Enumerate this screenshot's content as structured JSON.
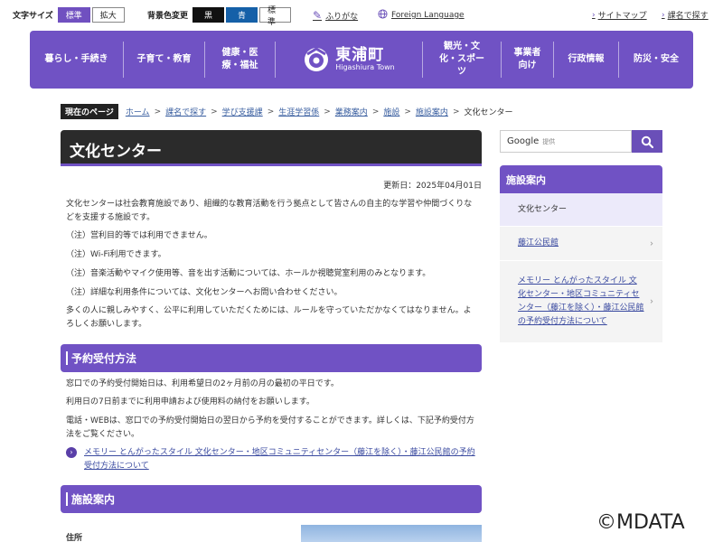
{
  "topbar": {
    "font_size_label": "文字サイズ",
    "font_size_options": [
      "標準",
      "拡大"
    ],
    "bg_label": "背景色変更",
    "bg_options": [
      "黒",
      "青",
      "標準"
    ],
    "furigana": "ふりがな",
    "foreign_language": "Foreign Language",
    "sitemap": "サイトマップ",
    "search_by_section": "課名で探す"
  },
  "nav": {
    "items_left": [
      "暮らし・手続き",
      "子育て・教育",
      "健康・医療・福祉"
    ],
    "logo_jp": "東浦町",
    "logo_en": "Higashiura Town",
    "items_right": [
      "観光・文化・スポーツ",
      "事業者向け",
      "行政情報",
      "防災・安全"
    ]
  },
  "breadcrumb": {
    "head": "現在のページ",
    "links": [
      "ホーム",
      "課名で探す",
      "学び支援課",
      "生涯学習係",
      "業務案内",
      "施設",
      "施設案内"
    ],
    "current": "文化センター"
  },
  "main": {
    "title": "文化センター",
    "updated": "更新日：2025年04月01日",
    "intro": "文化センターは社会教育施設であり、組織的な教育活動を行う拠点として皆さんの自主的な学習や仲間づくりなどを支援する施設です。",
    "notes": [
      "（注）営利目的等では利用できません。",
      "（注）Wi-Fi利用できます。",
      "（注）音楽活動やマイク使用等、音を出す活動については、ホールか視聴覚室利用のみとなります。",
      "（注）詳細な利用条件については、文化センターへお問い合わせください。"
    ],
    "closing": "多くの人に親しみやすく、公平に利用していただくためには、ルールを守っていただかなくてはなりません。よろしくお願いします。",
    "section1_title": "予約受付方法",
    "reserve_lines": [
      "窓口での予約受付開始日は、利用希望日の2ヶ月前の月の最初の平日です。",
      "利用日の7日前までに利用申請および使用料の納付をお願いします。",
      "電話・WEBは、窓口での予約受付開始日の翌日から予約を受付することができます。詳しくは、下記予約受付方法をご覧ください。"
    ],
    "reserve_link": "メモリー とんがったスタイル 文化センター・地区コミュニティセンター（藤江を除く）・藤江公民館の予約受付方法について",
    "section2_title": "施設案内",
    "address_label": "住所"
  },
  "sidebar": {
    "search_brand": "Google",
    "search_placeholder": "提供",
    "head": "施設案内",
    "items": [
      "文化センター",
      "藤江公民館",
      "メモリー とんがったスタイル 文化センター・地区コミュニティセンター（藤江を除く）・藤江公民館の予約受付方法について"
    ]
  },
  "watermark": "©MDATA",
  "colors": {
    "accent": "#7052c4",
    "title_bg": "#2b2b2b",
    "link": "#3a4aa0"
  }
}
